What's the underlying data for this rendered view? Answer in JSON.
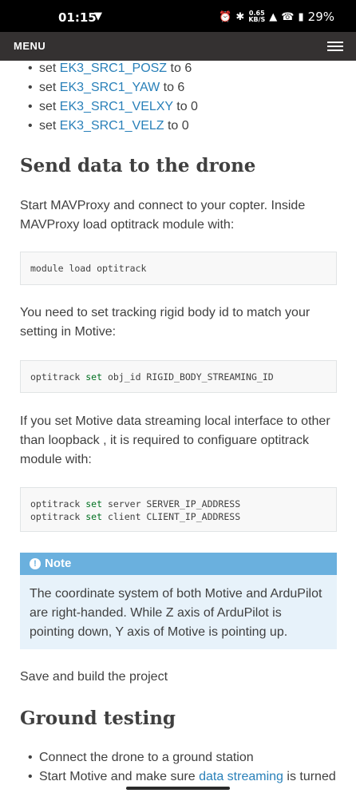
{
  "status": {
    "time": "01:15",
    "notif_icon": "shield-icon",
    "speed_value": "0.65",
    "speed_unit": "KB/S",
    "battery": "29%"
  },
  "menu": {
    "label": "MENU"
  },
  "bullets_top": [
    {
      "prefix": "set ",
      "link": "EK3_SRC1_POSZ",
      "suffix": " to 6"
    },
    {
      "prefix": "set ",
      "link": "EK3_SRC1_YAW",
      "suffix": " to 6"
    },
    {
      "prefix": "set ",
      "link": "EK3_SRC1_VELXY",
      "suffix": " to 0"
    },
    {
      "prefix": "set ",
      "link": "EK3_SRC1_VELZ",
      "suffix": " to 0"
    }
  ],
  "section1": {
    "title": "Send data to the drone",
    "intro": "Start MAVProxy and connect to your copter. Inside MAVProxy load optitrack module with:",
    "code1": "module load optitrack",
    "para2": "You need to set tracking rigid body id to match your setting in Motive:",
    "code2": {
      "pre": "optitrack ",
      "kw": "set",
      "post": " obj_id RIGID_BODY_STREAMING_ID"
    },
    "para3": "If you set Motive data streaming local interface to other than loopback , it is required to configuare optitrack module with:",
    "code3": [
      {
        "pre": "optitrack ",
        "kw": "set",
        "post": " server SERVER_IP_ADDRESS"
      },
      {
        "pre": "optitrack ",
        "kw": "set",
        "post": " client CLIENT_IP_ADDRESS"
      }
    ]
  },
  "note": {
    "title": "Note",
    "body": "The coordinate system of both Motive and ArduPilot are right-handed. While Z axis of ArduPilot is pointing down, Y axis of Motive is pointing up."
  },
  "save_text": "Save and build the project",
  "section2": {
    "title": "Ground testing",
    "bullet1": "Connect the drone to a ground station",
    "bullet2_prefix": "Start Motive and make sure ",
    "bullet2_link": "data streaming",
    "bullet2_suffix": " is turned"
  }
}
